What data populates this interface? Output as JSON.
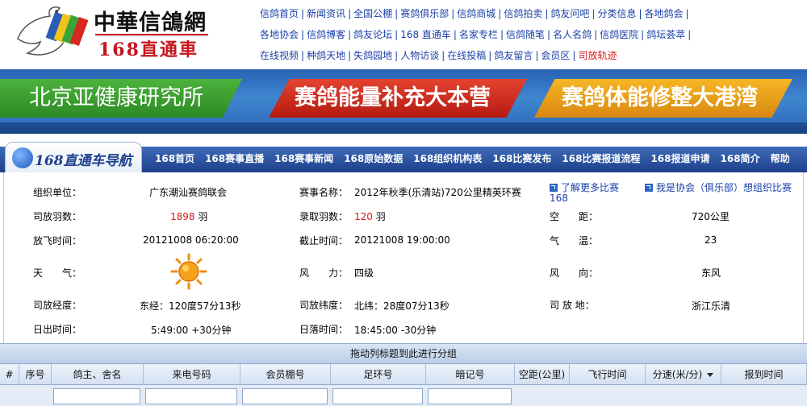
{
  "header": {
    "logo_title": "中華信鴿網",
    "logo_sub": "168直通車",
    "nav_rows": [
      [
        {
          "label": "信鸽首页"
        },
        {
          "label": "新闻资讯"
        },
        {
          "label": "全国公棚"
        },
        {
          "label": "赛鸽俱乐部"
        },
        {
          "label": "信鸽商城"
        },
        {
          "label": "信鸽拍卖"
        },
        {
          "label": "鸽友问吧"
        },
        {
          "label": "分类信息"
        },
        {
          "label": "各地鸽会"
        }
      ],
      [
        {
          "label": "各地协会"
        },
        {
          "label": "信鸽博客"
        },
        {
          "label": "鸽友论坛"
        },
        {
          "label": "168 直通车"
        },
        {
          "label": "名家专栏"
        },
        {
          "label": "信鸽随笔"
        },
        {
          "label": "名人名鸽"
        },
        {
          "label": "信鸽医院"
        },
        {
          "label": "鸽坛荟萃"
        }
      ],
      [
        {
          "label": "在线视频"
        },
        {
          "label": "种鸽天地"
        },
        {
          "label": "失鸽园地"
        },
        {
          "label": "人物访谈"
        },
        {
          "label": "在线投稿"
        },
        {
          "label": "鸽友留言"
        },
        {
          "label": "会员区"
        },
        {
          "label": "司放轨迹",
          "highlight": true
        }
      ]
    ]
  },
  "banner": {
    "green": "北京亚健康研究所",
    "red": "赛鸽能量补充大本营",
    "orange": "赛鸽体能修整大港湾"
  },
  "navbar": {
    "tab_title": "168直通车导航",
    "links": [
      "168首页",
      "168赛事直播",
      "168赛事新闻",
      "168原始数据",
      "168组织机构表",
      "168比赛发布",
      "168比赛报道流程",
      "168报道申请",
      "168简介",
      "帮助"
    ]
  },
  "info": {
    "org_label": "组织单位：",
    "org_value": "广东潮汕赛鸽联会",
    "event_label": "赛事名称：",
    "event_value": "2012年秋季(乐清站)720公里精英环赛",
    "more_link": "了解更多比赛",
    "more_link_2": "168",
    "assoc_link": "我是协会（俱乐部）想组织比赛",
    "released_label": "司放羽数：",
    "released_value": "1898",
    "released_unit": "羽",
    "accepted_label": "录取羽数：",
    "accepted_value": "120",
    "accepted_unit": "羽",
    "distance_label": "空　　距：",
    "distance_value": "720公里",
    "flytime_label": "放飞时间：",
    "flytime_value": "20121008 06:20:00",
    "deadline_label": "截止时间：",
    "deadline_value": "20121008 19:00:00",
    "temp_label": "气　　温：",
    "temp_value": "23",
    "weather_label": "天　　气：",
    "wind_label": "风　　力：",
    "wind_value": "四级",
    "winddir_label": "风　　向：",
    "winddir_value": "东风",
    "lng_label": "司放经度：",
    "lng_value": "东经：120度57分13秒",
    "lat_label": "司放纬度：",
    "lat_value": "北纬：28度07分13秒",
    "place_label": "司 放 地：",
    "place_value": "浙江乐清",
    "sunrise_label": "日出时间：",
    "sunrise_value": "5:49:00 +30分钟",
    "sunset_label": "日落时间：",
    "sunset_value": "18:45:00 -30分钟"
  },
  "grid": {
    "group_hint": "拖动列标题到此进行分组",
    "columns": [
      "#",
      "序号",
      "鸽主、舍名",
      "来电号码",
      "会员棚号",
      "足环号",
      "暗记号",
      "空距(公里)",
      "飞行时间",
      "分速(米/分)",
      "报到时间"
    ]
  },
  "colors": {
    "link": "#1a3fa8",
    "highlight": "#d11a1a",
    "nav_blue": "#1e3f8c"
  }
}
